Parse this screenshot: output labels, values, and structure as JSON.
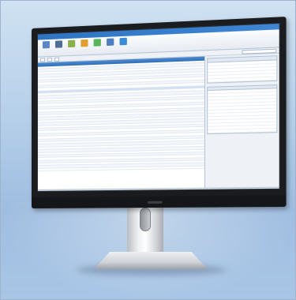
{
  "app": {
    "title": ""
  },
  "ribbon": {
    "buttons": [
      {
        "icon": "new-document-icon",
        "color": "#5b88c4",
        "label": ""
      },
      {
        "icon": "stack-icon",
        "color": "#4f6f99",
        "label": ""
      },
      {
        "icon": "sample-icon",
        "color": "#8ab04a",
        "label": ""
      },
      {
        "icon": "flag-icon",
        "color": "#e0a030",
        "label": ""
      },
      {
        "icon": "globe-icon",
        "color": "#59b35b",
        "label": ""
      },
      {
        "icon": "tools-icon",
        "color": "#4e7fc0",
        "label": ""
      },
      {
        "icon": "help-icon",
        "color": "#3a8ad6",
        "label": ""
      }
    ]
  },
  "tabs": [
    "",
    "",
    ""
  ],
  "table": {
    "columns": [
      "",
      "",
      "",
      "",
      "",
      "",
      ""
    ],
    "rows": [
      {
        "level": 0,
        "cells": [
          "",
          "",
          "",
          "",
          "",
          "",
          ""
        ]
      },
      {
        "level": 0,
        "cells": [
          "",
          "",
          "",
          "",
          "",
          "",
          ""
        ]
      },
      {
        "level": 0,
        "cells": [
          "",
          "",
          "",
          "",
          "",
          "",
          ""
        ]
      },
      {
        "level": 0,
        "cells": [
          "",
          "",
          "",
          "",
          "",
          "",
          ""
        ]
      },
      {
        "level": 0,
        "cells": [
          "",
          "",
          "",
          "",
          "",
          "",
          ""
        ]
      },
      {
        "level": 0,
        "cells": [
          "",
          "",
          "",
          "",
          "",
          "",
          ""
        ]
      },
      {
        "level": 0,
        "cells": [
          "",
          "",
          "",
          "",
          "",
          "",
          ""
        ]
      },
      {
        "level": 0,
        "cells": [
          "",
          "",
          "",
          "",
          "",
          "",
          ""
        ]
      },
      {
        "level": 0,
        "cells": [
          "",
          "",
          "",
          "",
          "",
          "",
          ""
        ]
      },
      {
        "level": 1,
        "cells": [
          "",
          "",
          "",
          "",
          "",
          "",
          ""
        ]
      },
      {
        "level": 1,
        "cells": [
          "",
          "",
          "",
          "",
          "",
          "",
          ""
        ]
      },
      {
        "level": 1,
        "cells": [
          "",
          "",
          "",
          "",
          "",
          "",
          ""
        ]
      },
      {
        "level": 1,
        "cells": [
          "",
          "",
          "",
          "",
          "",
          "",
          ""
        ]
      },
      {
        "level": 2,
        "cells": [
          "",
          "",
          "",
          "",
          "",
          "",
          ""
        ]
      },
      {
        "level": 2,
        "cells": [
          "",
          "",
          "",
          "",
          "",
          "",
          ""
        ]
      },
      {
        "level": 0,
        "cells": [
          "",
          "",
          "",
          "",
          "",
          "",
          ""
        ]
      },
      {
        "level": 0,
        "cells": [
          "",
          "",
          "",
          "",
          "",
          "",
          ""
        ]
      },
      {
        "level": 0,
        "cells": [
          "",
          "",
          "",
          "",
          "",
          "",
          ""
        ]
      },
      {
        "level": 0,
        "cells": [
          "",
          "",
          "",
          "",
          "",
          "",
          ""
        ]
      },
      {
        "level": 0,
        "cells": [
          "",
          "",
          "",
          "",
          "",
          "",
          ""
        ]
      },
      {
        "level": 0,
        "cells": [
          "",
          "",
          "",
          "",
          "",
          "",
          ""
        ]
      },
      {
        "level": 0,
        "cells": [
          "",
          "",
          "",
          "",
          "",
          "",
          ""
        ]
      },
      {
        "level": 0,
        "cells": [
          "",
          "",
          "",
          "",
          "",
          "",
          ""
        ]
      },
      {
        "level": 0,
        "cells": [
          "",
          "",
          "",
          "",
          "",
          "",
          ""
        ]
      },
      {
        "level": 0,
        "cells": [
          "",
          "",
          "",
          "",
          "",
          "",
          ""
        ]
      },
      {
        "level": 0,
        "cells": [
          "",
          "",
          "",
          "",
          "",
          "",
          ""
        ]
      },
      {
        "level": 0,
        "cells": [
          "",
          "",
          "",
          "",
          "",
          "",
          ""
        ]
      },
      {
        "level": 0,
        "cells": [
          "",
          "",
          "",
          "",
          "",
          "",
          ""
        ]
      },
      {
        "level": 0,
        "cells": [
          "",
          "",
          "",
          "",
          "",
          "",
          ""
        ]
      },
      {
        "level": 0,
        "cells": [
          "",
          "",
          "",
          "",
          "",
          "",
          ""
        ]
      },
      {
        "level": 0,
        "cells": [
          "",
          "",
          "",
          "",
          "",
          "",
          ""
        ]
      },
      {
        "level": 0,
        "cells": [
          "",
          "",
          "",
          "",
          "",
          "",
          ""
        ]
      },
      {
        "level": 0,
        "cells": [
          "",
          "",
          "",
          "",
          "",
          "",
          ""
        ]
      },
      {
        "level": 0,
        "cells": [
          "",
          "",
          "",
          "",
          "",
          "",
          ""
        ]
      },
      {
        "level": 0,
        "cells": [
          "",
          "",
          "",
          "",
          "",
          "",
          ""
        ]
      },
      {
        "level": 0,
        "cells": [
          "",
          "",
          "",
          "",
          "",
          "",
          ""
        ]
      },
      {
        "level": 0,
        "cells": [
          "",
          "",
          "",
          "",
          "",
          "",
          ""
        ]
      },
      {
        "level": 0,
        "cells": [
          "",
          "",
          "",
          "",
          "",
          "",
          ""
        ]
      },
      {
        "level": 0,
        "cells": [
          "",
          "",
          "",
          "",
          "",
          "",
          ""
        ]
      }
    ]
  },
  "side_panels": [
    {
      "title": "",
      "rows": [
        [
          "",
          ""
        ],
        [
          "",
          ""
        ],
        [
          "",
          ""
        ],
        [
          "",
          ""
        ],
        [
          "",
          ""
        ],
        [
          "",
          ""
        ]
      ]
    },
    {
      "title": "",
      "rows": [
        [
          "",
          ""
        ],
        [
          "",
          ""
        ],
        [
          "",
          ""
        ],
        [
          "",
          ""
        ],
        [
          "",
          ""
        ],
        [
          "",
          ""
        ],
        [
          "",
          ""
        ],
        [
          "",
          ""
        ],
        [
          "",
          ""
        ],
        [
          "",
          ""
        ],
        [
          "",
          ""
        ],
        [
          "",
          ""
        ],
        [
          "",
          ""
        ]
      ]
    }
  ],
  "status": {
    "text": ""
  },
  "colors": {
    "titlebar": "#2e74c2",
    "header": "#2f6fb8",
    "background_sky": "#b7d0ea"
  }
}
